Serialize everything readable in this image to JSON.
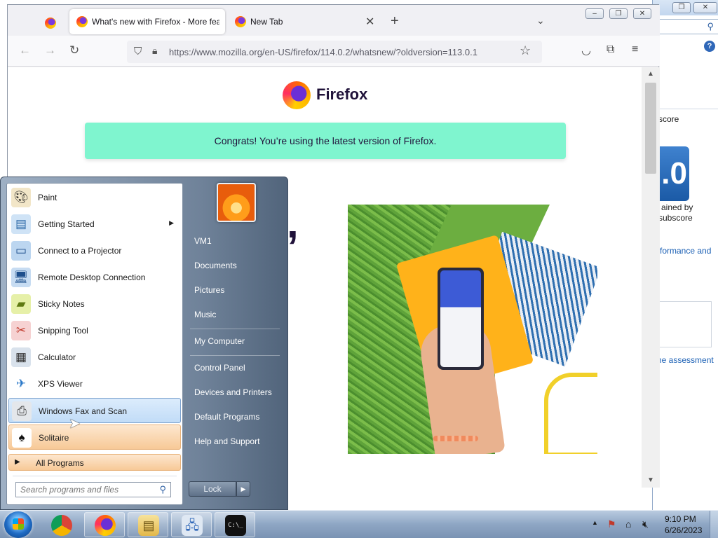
{
  "background_window": {
    "partial_texts": [
      "score",
      "ained by",
      "subscore",
      "formance and",
      "he assessment"
    ],
    "score_fragment": ".0"
  },
  "firefox": {
    "tabs": [
      {
        "title": "What's new with Firefox - More features, quick",
        "active": true
      },
      {
        "title": "New Tab",
        "active": false
      }
    ],
    "url": "https://www.mozilla.org/en-US/firefox/114.0.2/whatsnew/?oldversion=113.0.1",
    "page": {
      "brand": "Firefox",
      "banner": "Congrats! You’re using the latest version of Firefox.",
      "headline_fragment": ","
    },
    "accent_color": "#7ff5cf"
  },
  "start_menu": {
    "programs": [
      {
        "label": "Paint",
        "icon": "paint-icon",
        "state": "normal"
      },
      {
        "label": "Getting Started",
        "icon": "getting-started-icon",
        "state": "normal",
        "submenu": true
      },
      {
        "label": "Connect to a Projector",
        "icon": "projector-icon",
        "state": "normal"
      },
      {
        "label": "Remote Desktop Connection",
        "icon": "remote-desktop-icon",
        "state": "normal"
      },
      {
        "label": "Sticky Notes",
        "icon": "sticky-notes-icon",
        "state": "normal"
      },
      {
        "label": "Snipping Tool",
        "icon": "snipping-tool-icon",
        "state": "normal"
      },
      {
        "label": "Calculator",
        "icon": "calculator-icon",
        "state": "normal"
      },
      {
        "label": "XPS Viewer",
        "icon": "xps-viewer-icon",
        "state": "normal"
      },
      {
        "label": "Windows Fax and Scan",
        "icon": "fax-scan-icon",
        "state": "hover"
      },
      {
        "label": "Solitaire",
        "icon": "solitaire-icon",
        "state": "pinned"
      }
    ],
    "all_programs": "All Programs",
    "search_placeholder": "Search programs and files",
    "right_links": [
      "VM1",
      "Documents",
      "Pictures",
      "Music",
      "My Computer",
      "Control Panel",
      "Devices and Printers",
      "Default Programs",
      "Help and Support"
    ],
    "lock_label": "Lock"
  },
  "taskbar": {
    "apps": [
      "chrome-icon",
      "firefox-icon",
      "explorer-icon",
      "network-icon",
      "cmd-icon"
    ],
    "cmd_text": "C:\\_",
    "clock_time": "9:10 PM",
    "clock_date": "6/26/2023"
  }
}
